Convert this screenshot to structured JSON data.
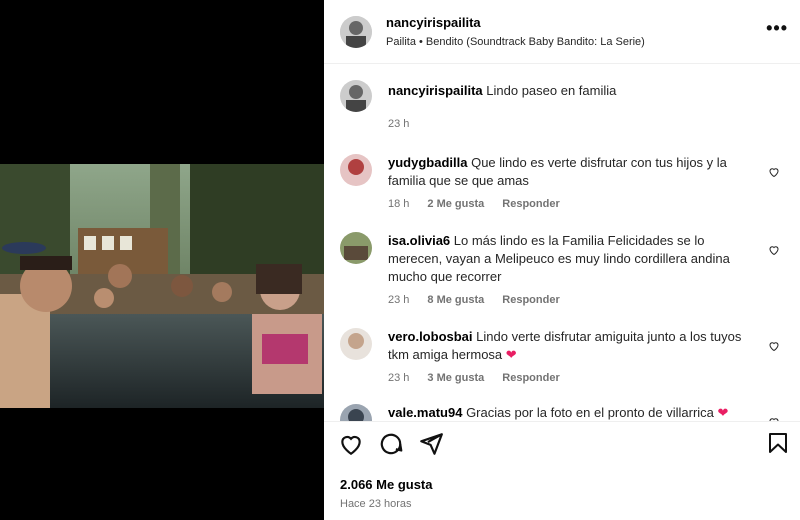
{
  "post": {
    "author": "nancyirispailita",
    "song": "Pailita • Bendito (Soundtrack Baby Bandito: La Serie)",
    "caption": "Lindo paseo en familia",
    "caption_time": "23 h"
  },
  "comments": [
    {
      "user": "yudygbadilla",
      "text": "Que lindo es verte disfrutar con tus hijos y la familia que se que amas",
      "time": "18 h",
      "likes": "2 Me gusta",
      "reply": "Responder"
    },
    {
      "user": "isa.olivia6",
      "text": "Lo más lindo es la Familia Felicidades se lo merecen, vayan a Melipeuco es muy lindo cordillera andina mucho que recorrer",
      "time": "23 h",
      "likes": "8 Me gusta",
      "reply": "Responder"
    },
    {
      "user": "vero.lobosbai",
      "text": "Lindo verte disfrutar amiguita junto a los tuyos tkm amiga hermosa",
      "emoji": "❤",
      "time": "23 h",
      "likes": "3 Me gusta",
      "reply": "Responder"
    },
    {
      "user": "vale.matu94",
      "text": "Gracias por la foto en el pronto de villarrica",
      "emoji": "❤"
    }
  ],
  "footer": {
    "likes": "2.066 Me gusta",
    "posted": "Hace 23 horas"
  },
  "icons": [
    "more-options-icon",
    "heart-icon",
    "comment-icon",
    "share-icon",
    "save-icon"
  ]
}
